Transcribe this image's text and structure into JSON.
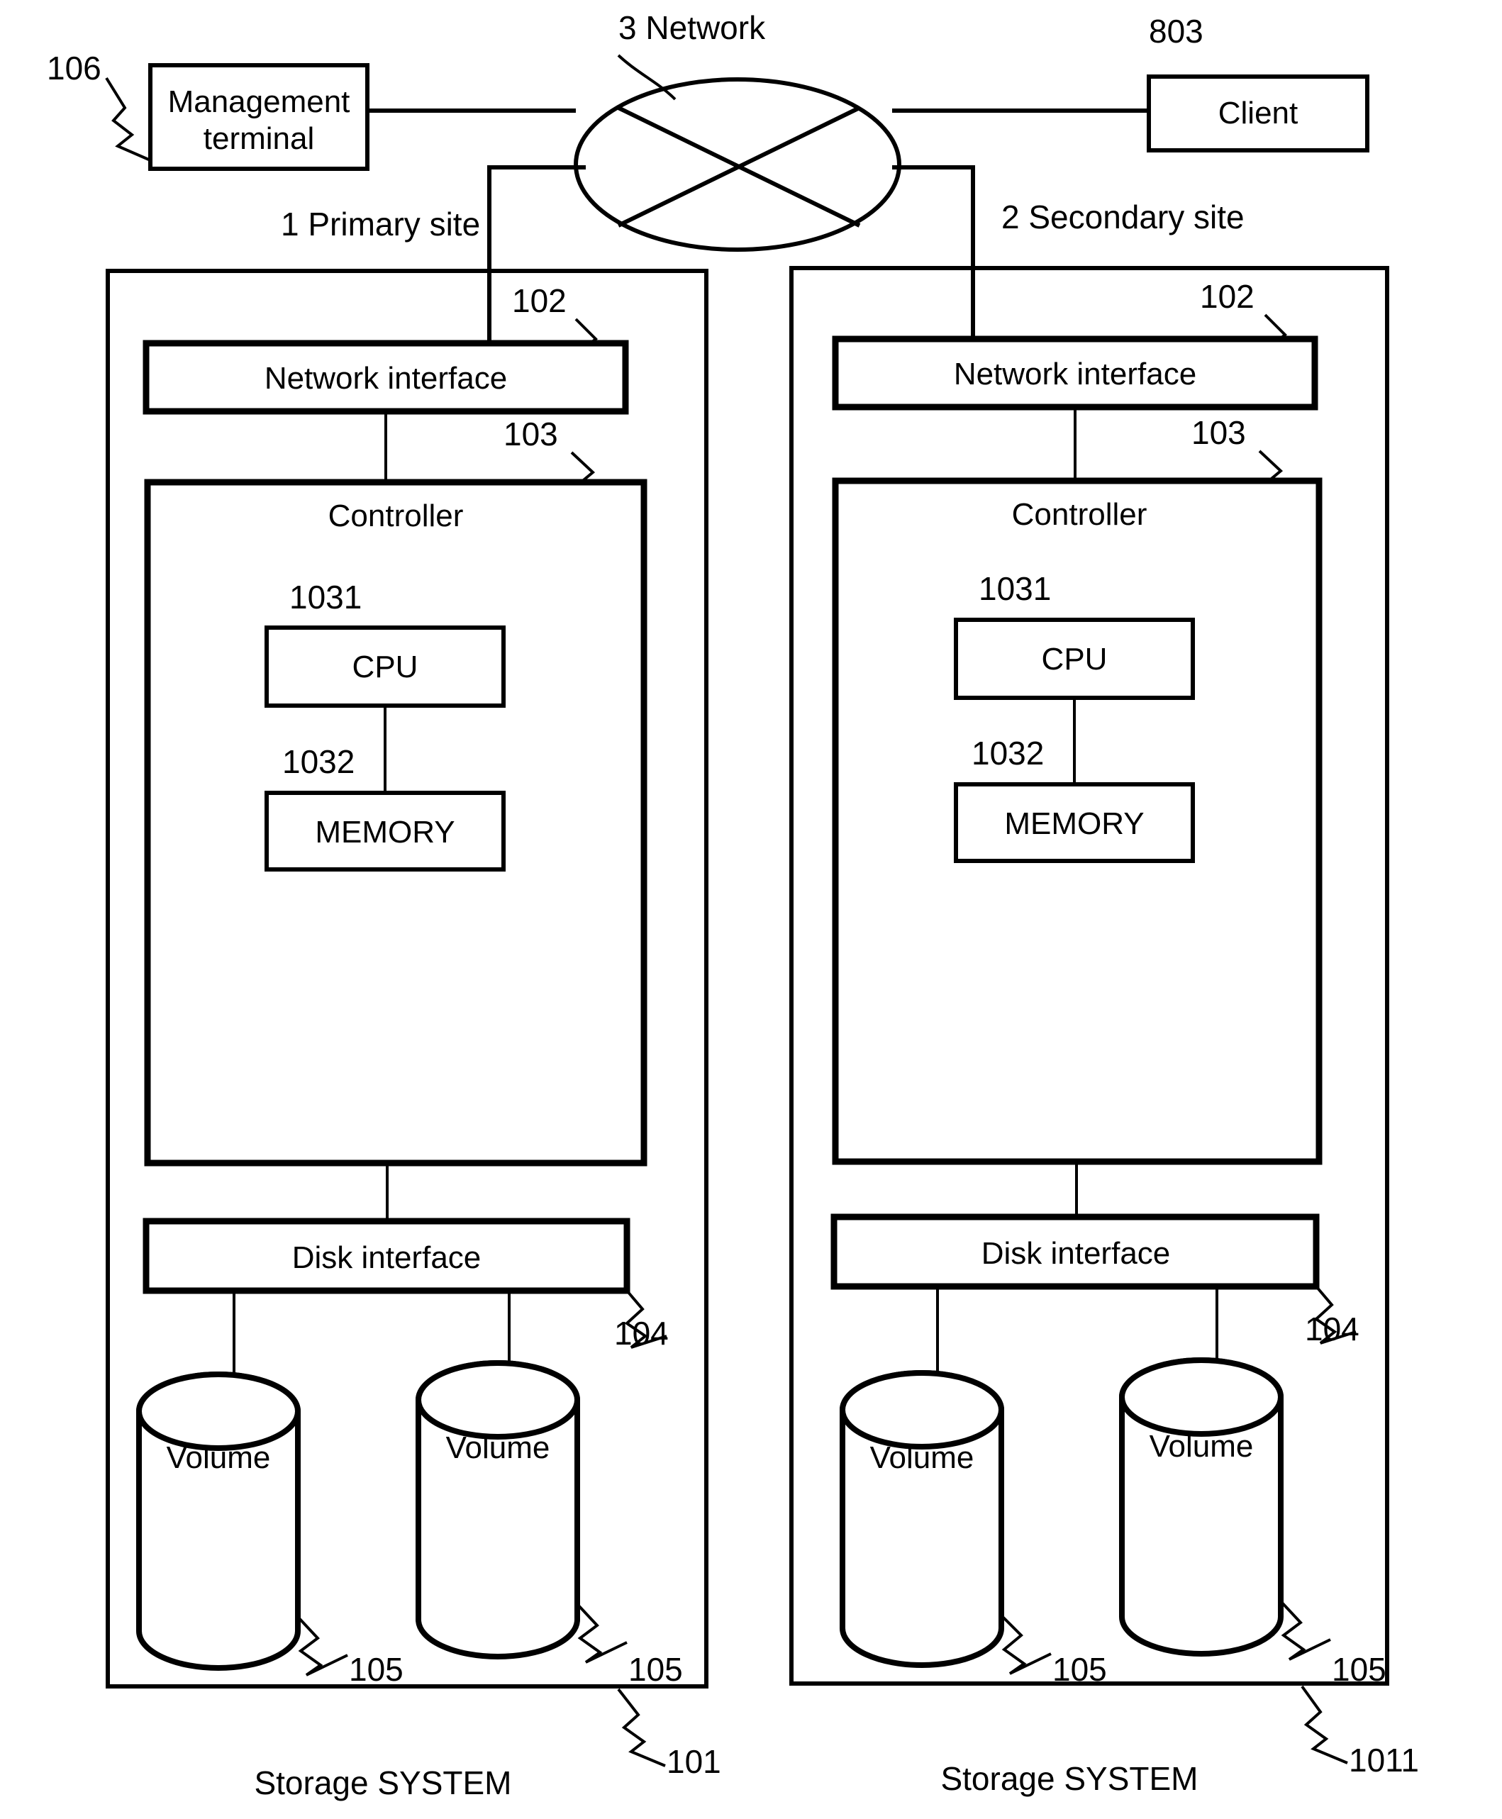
{
  "figure": {
    "title_nodes": {
      "network_label": "3 Network",
      "primary_site_label": "1   Primary site",
      "secondary_site_label": "2  Secondary site"
    },
    "top_components": {
      "management_terminal": {
        "line1": "Management",
        "line2": "terminal",
        "ref": "106"
      },
      "client": {
        "label": "Client",
        "ref": "803"
      }
    },
    "sites": [
      {
        "site_name": "primary",
        "site_label": "1   Primary site",
        "system_label": "Storage SYSTEM",
        "system_ref": "101",
        "network_interface": {
          "label": "Network interface",
          "ref": "102"
        },
        "controller": {
          "label": "Controller",
          "ref": "103",
          "cpu": {
            "label": "CPU",
            "ref": "1031"
          },
          "memory": {
            "label": "MEMORY",
            "ref": "1032"
          }
        },
        "disk_interface": {
          "label": "Disk interface",
          "ref": "104"
        },
        "volumes": [
          {
            "label": "Volume",
            "ref": "105"
          },
          {
            "label": "Volume",
            "ref": "105"
          }
        ]
      },
      {
        "site_name": "secondary",
        "site_label": "2  Secondary site",
        "system_label": "Storage SYSTEM",
        "system_ref": "1011",
        "network_interface": {
          "label": "Network interface",
          "ref": "102"
        },
        "controller": {
          "label": "Controller",
          "ref": "103",
          "cpu": {
            "label": "CPU",
            "ref": "1031"
          },
          "memory": {
            "label": "MEMORY",
            "ref": "1032"
          }
        },
        "disk_interface": {
          "label": "Disk interface",
          "ref": "104"
        },
        "volumes": [
          {
            "label": "Volume",
            "ref": "105"
          },
          {
            "label": "Volume",
            "ref": "105"
          }
        ]
      }
    ],
    "colors": {
      "ink": "#000000",
      "paper": "#ffffff"
    }
  }
}
